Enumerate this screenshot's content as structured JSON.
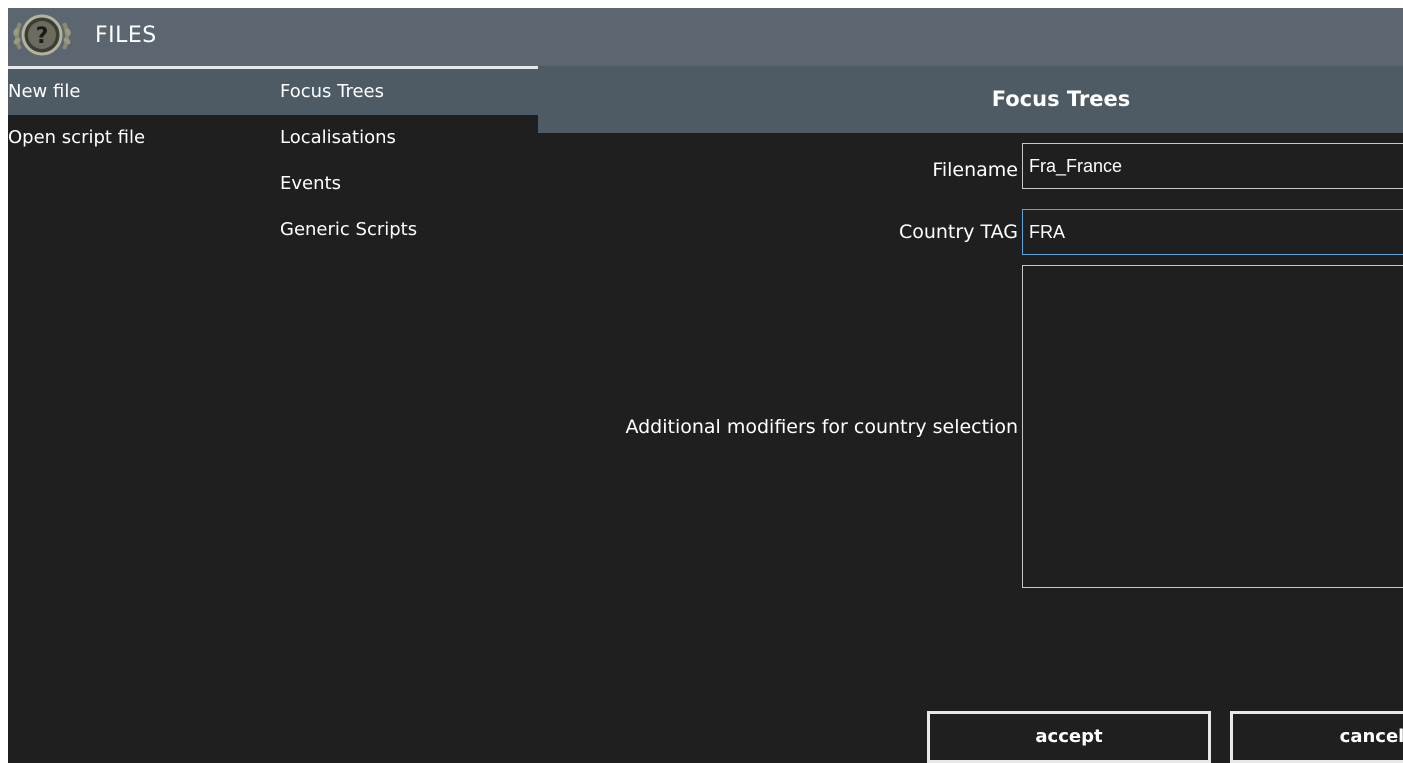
{
  "window": {
    "title": "FILES",
    "logo_icon": "question-mark-laurel-emblem"
  },
  "left_menu": {
    "main_items": [
      {
        "label": "New file",
        "selected": true
      },
      {
        "label": "Open script file",
        "selected": false
      }
    ],
    "sub_items": [
      {
        "label": "Focus Trees",
        "selected": true
      },
      {
        "label": "Localisations",
        "selected": false
      },
      {
        "label": "Events",
        "selected": false
      },
      {
        "label": "Generic Scripts",
        "selected": false
      }
    ]
  },
  "panel": {
    "header": "Focus Trees",
    "filename_label": "Filename",
    "filename_value": "Fra_France",
    "country_tag_label": "Country TAG",
    "country_tag_value": "FRA",
    "modifiers_label": "Additional modifiers for country selection",
    "modifiers_value": ""
  },
  "buttons": {
    "accept": "accept",
    "cancel": "cancel"
  },
  "colors": {
    "background": "#1f1f1f",
    "titlebar": "#5b6670",
    "selected": "#4e5a64",
    "focus_border": "#5ba3d8",
    "text": "#ffffff"
  }
}
